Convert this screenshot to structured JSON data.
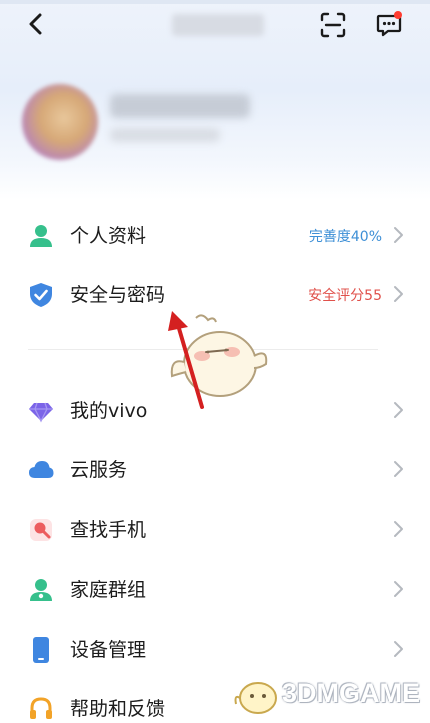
{
  "menu": {
    "items": [
      {
        "label": "个人资料",
        "meta": "完善度40%",
        "meta_color": "#3d8fd6",
        "icon": "person-icon"
      },
      {
        "label": "安全与密码",
        "meta": "安全评分55",
        "meta_color": "#e0514b",
        "icon": "shield-icon"
      },
      {
        "label": "我的vivo",
        "meta": "",
        "icon": "diamond-icon"
      },
      {
        "label": "云服务",
        "meta": "",
        "icon": "cloud-icon"
      },
      {
        "label": "查找手机",
        "meta": "",
        "icon": "find-phone-icon"
      },
      {
        "label": "家庭群组",
        "meta": "",
        "icon": "family-icon"
      },
      {
        "label": "设备管理",
        "meta": "",
        "icon": "device-icon"
      },
      {
        "label": "帮助和反馈",
        "meta": "",
        "icon": "headset-icon"
      }
    ]
  },
  "watermark": {
    "text": "3DMGAME"
  },
  "colors": {
    "accent": "#3d8fd6",
    "warning": "#e0514b",
    "green": "#36c08c"
  }
}
